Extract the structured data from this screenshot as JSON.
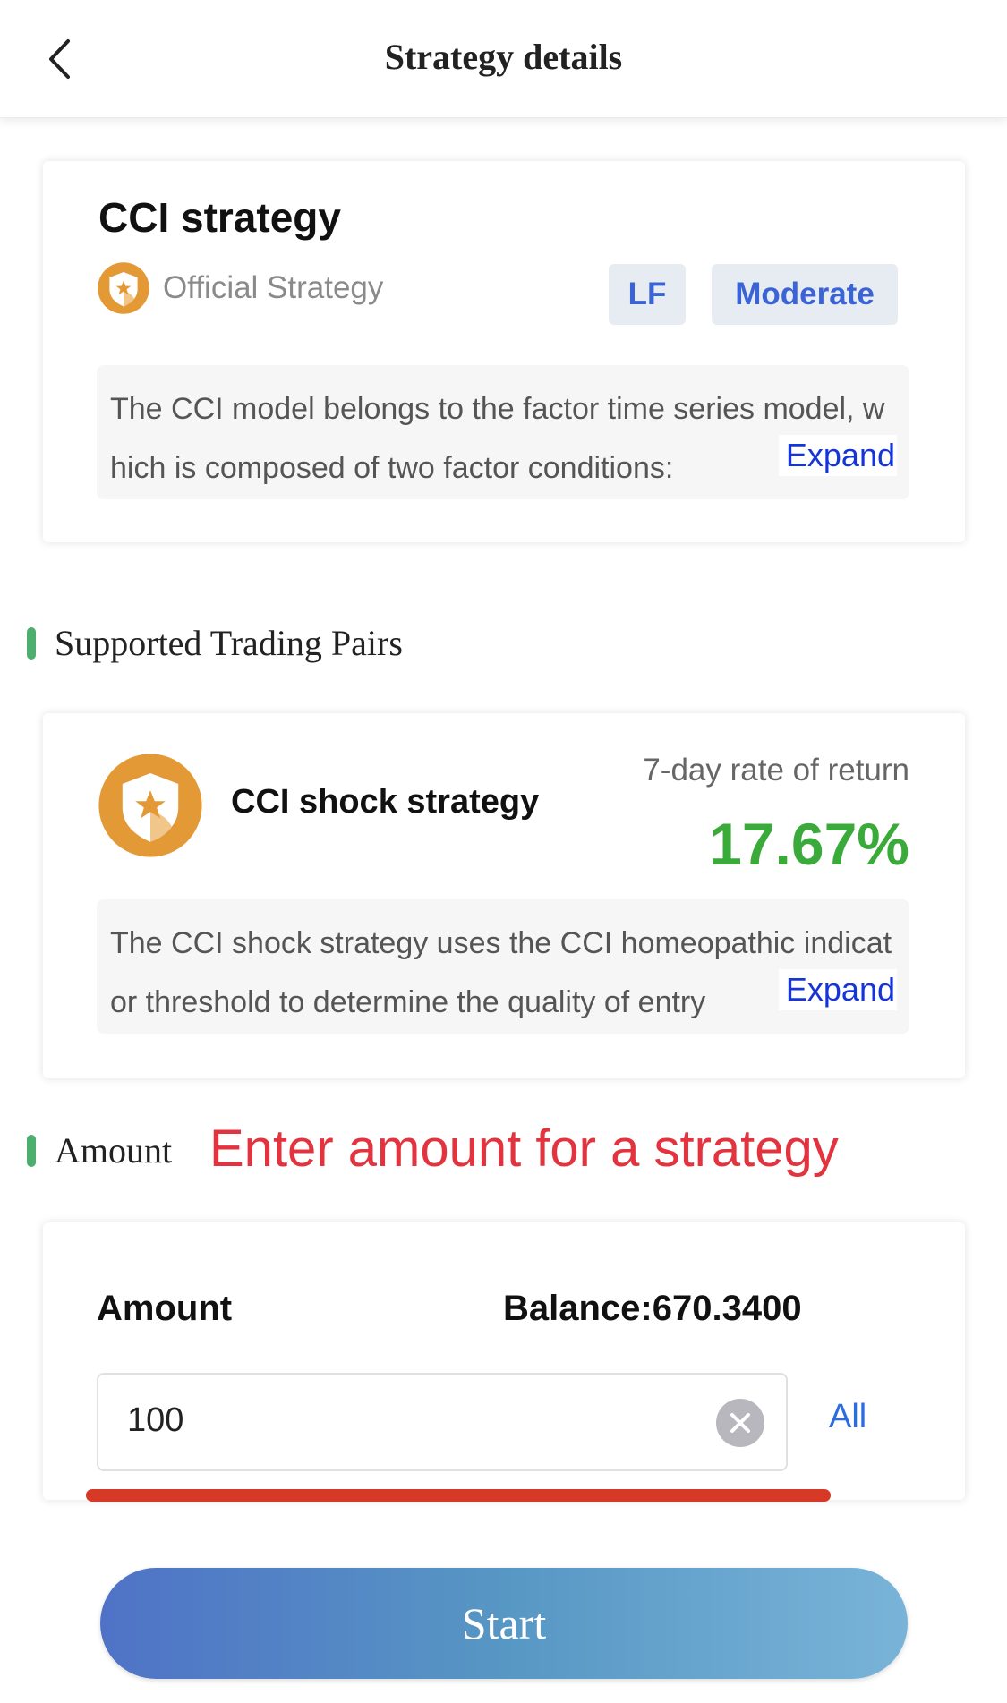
{
  "nav": {
    "title": "Strategy details"
  },
  "strategy": {
    "name": "CCI strategy",
    "source_label": "Official Strategy",
    "tags": [
      "LF",
      "Moderate"
    ],
    "description": "The CCI model belongs to the factor time series model, which is composed of two factor conditions:",
    "expand_label": "Expand"
  },
  "pairs_section": {
    "title": "Supported Trading Pairs"
  },
  "pair": {
    "name": "CCI shock strategy",
    "return_label": "7-day rate of return",
    "return_value": "17.67%",
    "description": "The CCI shock strategy uses the CCI homeopathic indicator threshold to determine the quality of entry",
    "expand_label": "Expand"
  },
  "amount_section": {
    "title": "Amount",
    "hint": "Enter amount for a strategy"
  },
  "amount_card": {
    "label": "Amount",
    "balance": "Balance:670.3400",
    "input_value": "100",
    "all_label": "All"
  },
  "start_button": {
    "label": "Start"
  },
  "colors": {
    "accent_blue": "#3a63d6",
    "return_green": "#3aab3a",
    "hint_red": "#e2333f",
    "section_bar": "#4caf6d",
    "link_blue": "#1535d9",
    "badge_orange": "#e39a36"
  },
  "icons": {
    "back": "chevron-left-icon",
    "official": "shield-star-icon",
    "clear": "clear-icon"
  }
}
